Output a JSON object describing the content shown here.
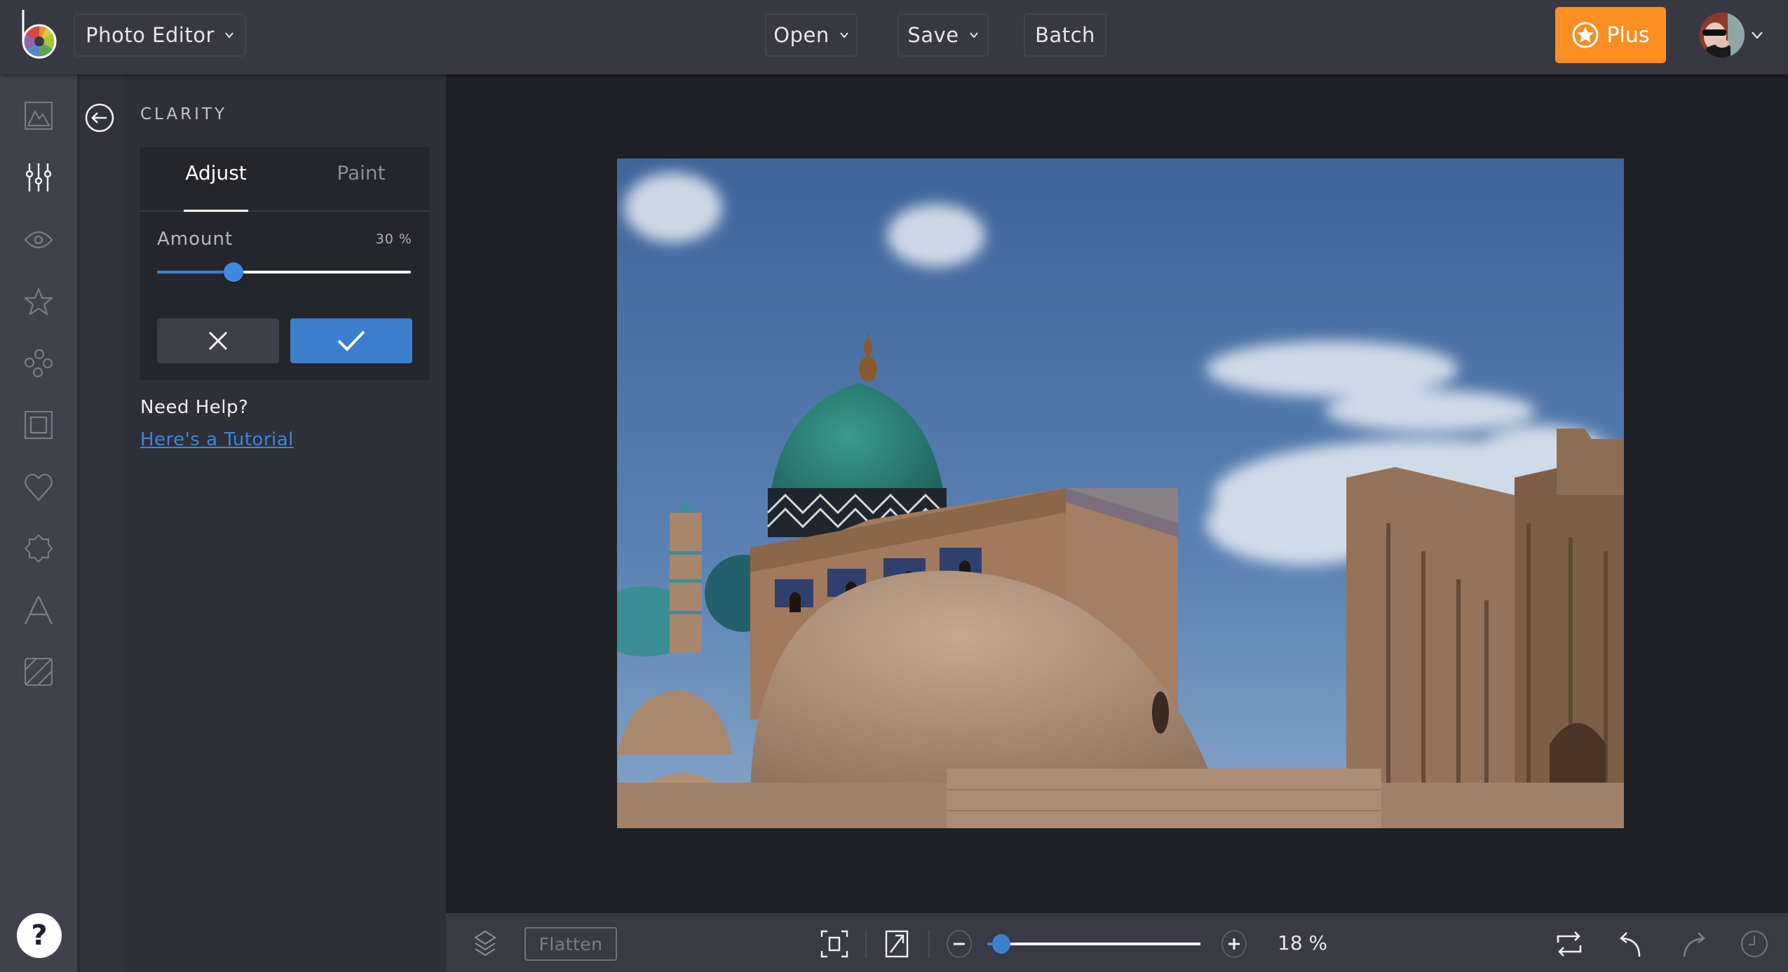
{
  "topbar": {
    "app_select": "Photo Editor",
    "open_label": "Open",
    "save_label": "Save",
    "batch_label": "Batch",
    "plus_label": "Plus",
    "accent_color": "#fb8f22"
  },
  "rail": {
    "items": [
      {
        "name": "image-icon",
        "tooltip": "Edit"
      },
      {
        "name": "sliders-icon",
        "tooltip": "Adjust",
        "active": true
      },
      {
        "name": "eye-icon",
        "tooltip": "Effects"
      },
      {
        "name": "star-icon",
        "tooltip": "Favorites"
      },
      {
        "name": "circles-icon",
        "tooltip": "Touch Up"
      },
      {
        "name": "frame-icon",
        "tooltip": "Frames"
      },
      {
        "name": "heart-icon",
        "tooltip": "Graphics"
      },
      {
        "name": "badge-icon",
        "tooltip": "Stickers"
      },
      {
        "name": "text-icon",
        "tooltip": "Text"
      },
      {
        "name": "texture-icon",
        "tooltip": "Textures"
      }
    ],
    "help_label": "?"
  },
  "panel": {
    "title": "CLARITY",
    "tabs": [
      {
        "label": "Adjust",
        "active": true
      },
      {
        "label": "Paint",
        "active": false
      }
    ],
    "amount_label": "Amount",
    "amount_value_text": "30 %",
    "amount_value": 30,
    "amount_max": 100,
    "help_heading": "Need Help?",
    "help_link": "Here's a Tutorial",
    "apply_color": "#3b7fcc"
  },
  "bottombar": {
    "flatten_label": "Flatten",
    "zoom_text": "18 %",
    "zoom_fraction": 0.04
  }
}
